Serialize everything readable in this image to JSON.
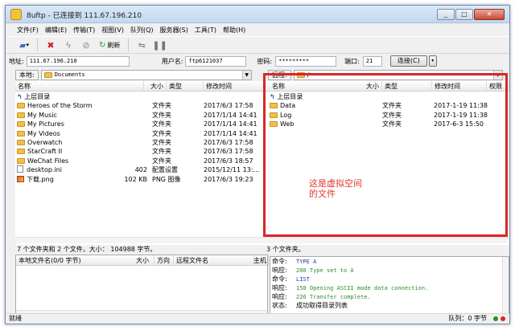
{
  "window": {
    "title": "8uftp - 已连接到 111.67.196.210",
    "min": "_",
    "max": "□",
    "close": "✕"
  },
  "menu": [
    "文件(F)",
    "编辑(E)",
    "传输(T)",
    "视图(V)",
    "队列(Q)",
    "服务器(S)",
    "工具(T)",
    "帮助(H)"
  ],
  "toolbar": {
    "refresh_label": "刷新"
  },
  "conn": {
    "addr_label": "地址:",
    "addr": "111.67.196.210",
    "user_label": "用户名:",
    "user": "ftp6121037",
    "pass_label": "密码:",
    "pass": "*********",
    "port_label": "端口:",
    "port": "21",
    "connect_label": "连接(C)"
  },
  "local": {
    "path_label": "本地:",
    "path": "Documents",
    "cols": [
      "名称",
      "大小",
      "类型",
      "修改时间"
    ],
    "up": "上层目录",
    "rows": [
      {
        "name": "Heroes of the Storm",
        "size": "",
        "type": "文件夹",
        "time": "2017/6/3 17:58"
      },
      {
        "name": "My Music",
        "size": "",
        "type": "文件夹",
        "time": "2017/1/14 14:41"
      },
      {
        "name": "My Pictures",
        "size": "",
        "type": "文件夹",
        "time": "2017/1/14 14:41"
      },
      {
        "name": "My Videos",
        "size": "",
        "type": "文件夹",
        "time": "2017/1/14 14:41"
      },
      {
        "name": "Overwatch",
        "size": "",
        "type": "文件夹",
        "time": "2017/6/3 17:58"
      },
      {
        "name": "StarCraft II",
        "size": "",
        "type": "文件夹",
        "time": "2017/6/3 17:58"
      },
      {
        "name": "WeChat Files",
        "size": "",
        "type": "文件夹",
        "time": "2017/6/3 18:57"
      },
      {
        "name": "desktop.ini",
        "size": "402",
        "type": "配置设置",
        "time": "2015/12/11 13:..."
      },
      {
        "name": "下载.png",
        "size": "102 KB",
        "type": "PNG 图像",
        "time": "2017/6/3 19:23"
      }
    ],
    "status": "7 个文件夹和 2 个文件，大小： 104988 字节。"
  },
  "remote": {
    "path_label": "远程:",
    "path": "/",
    "cols": [
      "名称",
      "大小",
      "类型",
      "修改时间",
      "权限"
    ],
    "up": "上层目录",
    "rows": [
      {
        "name": "Data",
        "size": "",
        "type": "文件夹",
        "time": "2017-1-19 11:38"
      },
      {
        "name": "Log",
        "size": "",
        "type": "文件夹",
        "time": "2017-1-19 11:38"
      },
      {
        "name": "Web",
        "size": "",
        "type": "文件夹",
        "time": "2017-6-3 15:50"
      }
    ],
    "status": "3 个文件夹。",
    "note": "这是虚拟空间的文件"
  },
  "queue": {
    "cols": [
      "本地文件名(0/0 字节)",
      "大小",
      "方向",
      "远程文件名",
      "主机"
    ]
  },
  "log": [
    {
      "tag": "命令:",
      "msg": "TYPE A"
    },
    {
      "tag": "响应:",
      "msg": "200 Type set to A"
    },
    {
      "tag": "命令:",
      "msg": "LIST"
    },
    {
      "tag": "响应:",
      "msg": "150 Opening ASCII mode data connection."
    },
    {
      "tag": "响应:",
      "msg": "226 Transfer complete."
    },
    {
      "tag": "状态:",
      "msg": "成功取得目录列表"
    }
  ],
  "statusbar": {
    "left": "就绪",
    "right": "队列：0 字节"
  },
  "colors": {
    "highlight": "#d9262a",
    "log_green": "#2e8b2e",
    "log_blue": "#1b3ea8"
  }
}
